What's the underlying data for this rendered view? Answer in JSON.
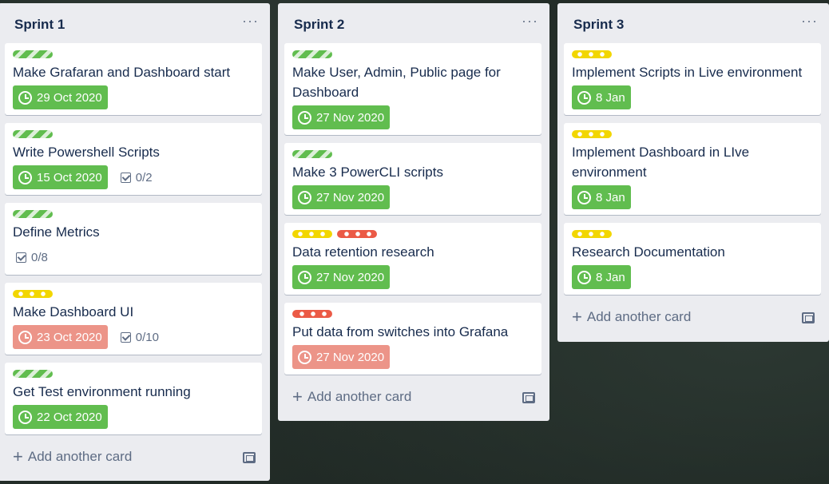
{
  "board": {
    "colors": {
      "green": "#61bd4f",
      "yellow": "#f2d600",
      "red": "#eb5a46",
      "due_overdue": "#ec9488"
    },
    "add_card_label": "Add another card",
    "lists": [
      {
        "title": "Sprint 1",
        "menu": "···",
        "cards": [
          {
            "title": "Make Grafaran and Dashboard start",
            "labels": [
              "green"
            ],
            "due": "29 Oct 2020",
            "due_status": "complete",
            "checklist": null
          },
          {
            "title": "Write Powershell Scripts",
            "labels": [
              "green"
            ],
            "due": "15 Oct 2020",
            "due_status": "complete",
            "checklist": "0/2"
          },
          {
            "title": "Define Metrics",
            "labels": [
              "green"
            ],
            "due": null,
            "checklist": "0/8"
          },
          {
            "title": "Make Dashboard UI",
            "labels": [
              "yellow"
            ],
            "due": "23 Oct 2020",
            "due_status": "overdue",
            "checklist": "0/10"
          },
          {
            "title": "Get Test environment running",
            "labels": [
              "green"
            ],
            "due": "22 Oct 2020",
            "due_status": "complete",
            "checklist": null
          }
        ]
      },
      {
        "title": "Sprint 2",
        "menu": "···",
        "cards": [
          {
            "title": "Make User, Admin, Public page for Dashboard",
            "labels": [
              "green"
            ],
            "due": "27 Nov 2020",
            "due_status": "complete",
            "checklist": null
          },
          {
            "title": "Make 3 PowerCLI scripts",
            "labels": [
              "green"
            ],
            "due": "27 Nov 2020",
            "due_status": "complete",
            "checklist": null
          },
          {
            "title": "Data retention research",
            "labels": [
              "yellow",
              "red"
            ],
            "due": "27 Nov 2020",
            "due_status": "complete",
            "checklist": null
          },
          {
            "title": "Put data from switches into Grafana",
            "labels": [
              "red"
            ],
            "due": "27 Nov 2020",
            "due_status": "overdue",
            "checklist": null
          }
        ]
      },
      {
        "title": "Sprint 3",
        "menu": "···",
        "cards": [
          {
            "title": "Implement Scripts in Live environment",
            "labels": [
              "yellow"
            ],
            "due": "8 Jan",
            "due_status": "complete",
            "checklist": null
          },
          {
            "title": "Implement Dashboard in LIve environment",
            "labels": [
              "yellow"
            ],
            "due": "8 Jan",
            "due_status": "complete",
            "checklist": null
          },
          {
            "title": "Research Documentation",
            "labels": [
              "yellow"
            ],
            "due": "8 Jan",
            "due_status": "complete",
            "checklist": null
          }
        ]
      }
    ]
  }
}
